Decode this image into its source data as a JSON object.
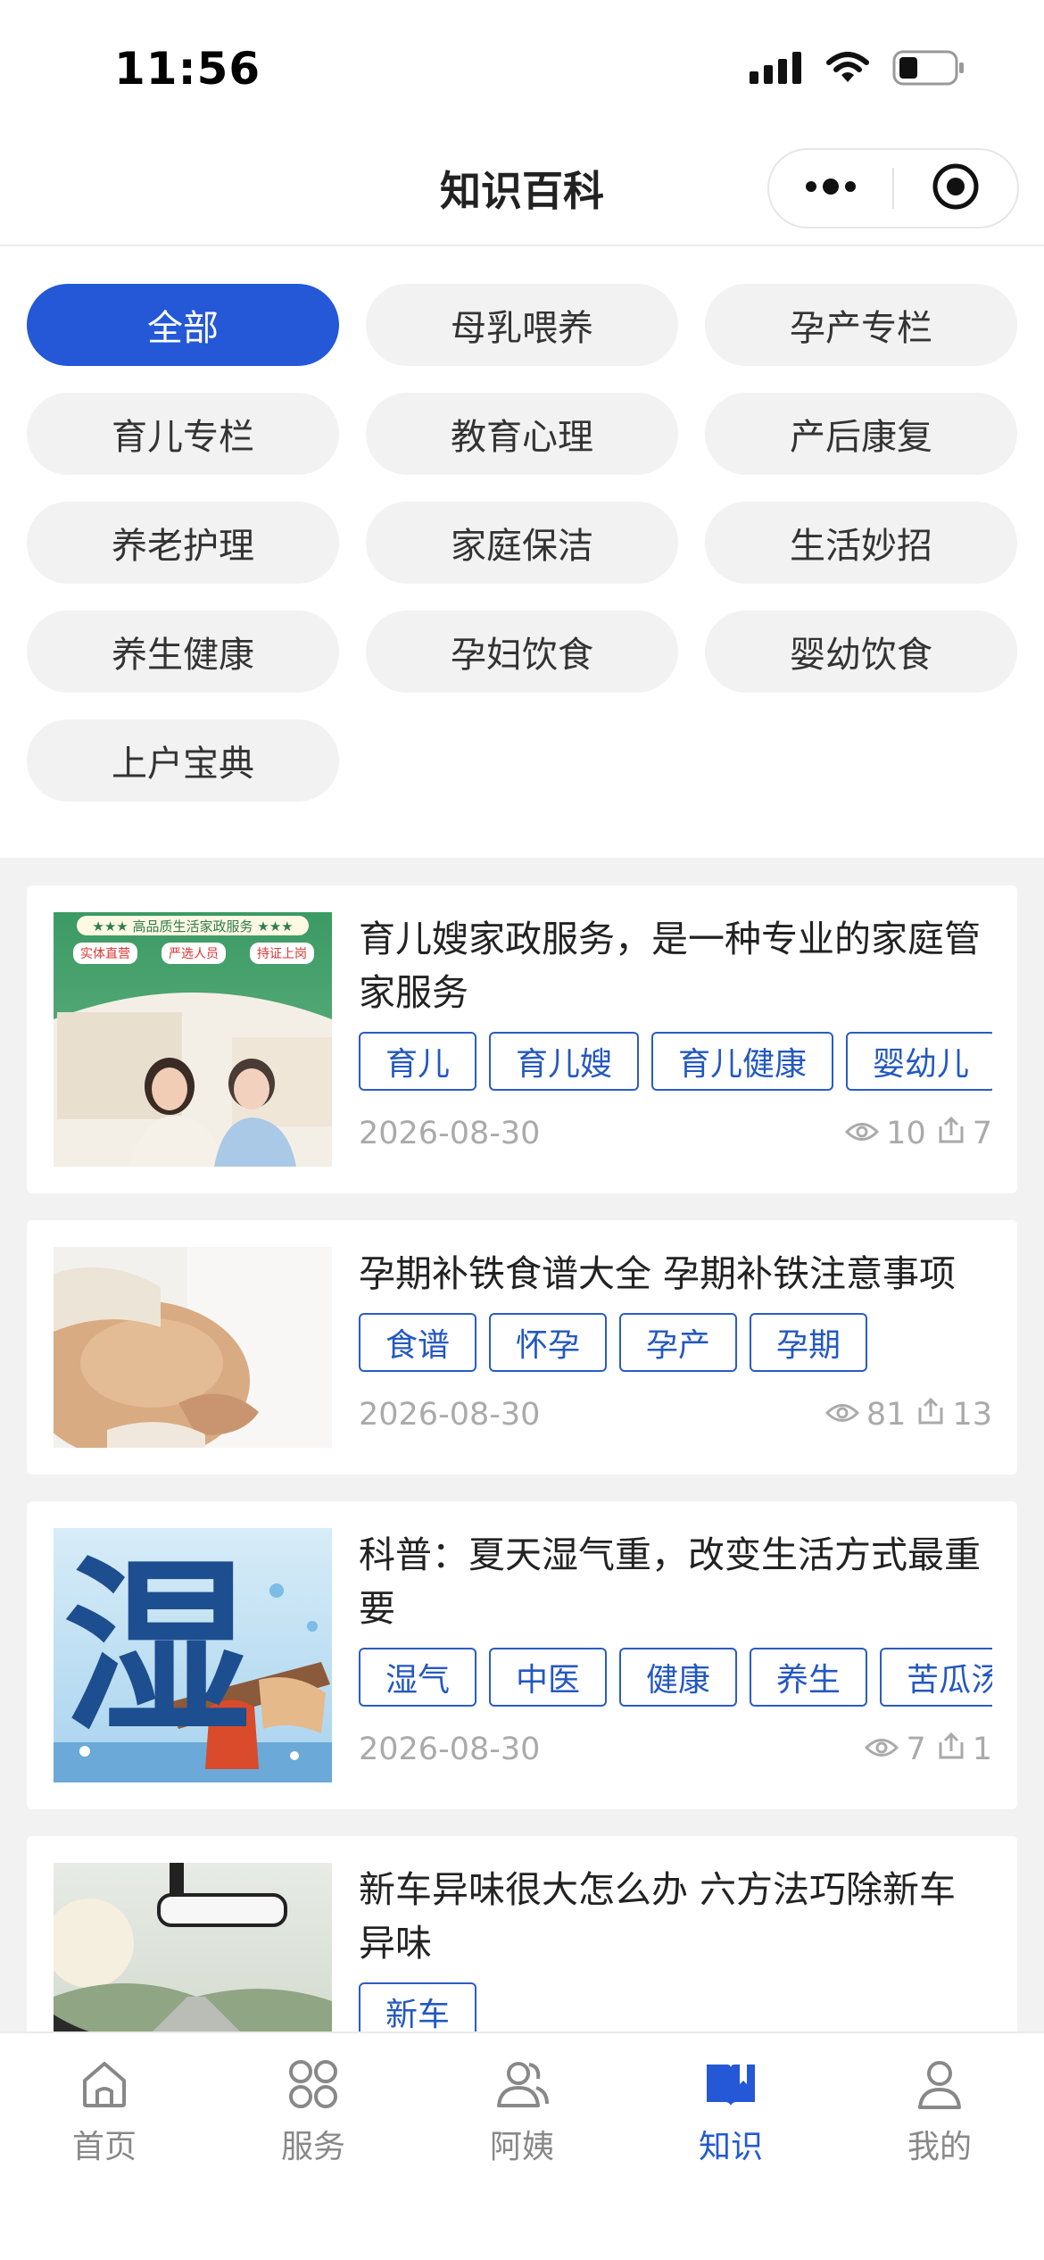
{
  "status_bar": {
    "time": "11:56"
  },
  "nav": {
    "title": "知识百科"
  },
  "categories": [
    {
      "label": "全部",
      "active": true
    },
    {
      "label": "母乳喂养"
    },
    {
      "label": "孕产专栏"
    },
    {
      "label": "育儿专栏"
    },
    {
      "label": "教育心理"
    },
    {
      "label": "产后康复"
    },
    {
      "label": "养老护理"
    },
    {
      "label": "家庭保洁"
    },
    {
      "label": "生活妙招"
    },
    {
      "label": "养生健康"
    },
    {
      "label": "孕妇饮食"
    },
    {
      "label": "婴幼饮食"
    },
    {
      "label": "上户宝典"
    }
  ],
  "articles": [
    {
      "title": "育儿嫂家政服务，是一种专业的家庭管家服务",
      "tags": [
        "育儿",
        "育儿嫂",
        "育儿健康",
        "婴幼儿"
      ],
      "date": "2026-08-30",
      "views": "10",
      "shares": "7",
      "thumb_text": {
        "banner": "★★★ 高品质生活家政服务 ★★★",
        "badges": [
          "实体直营",
          "严选人员",
          "持证上岗"
        ]
      }
    },
    {
      "title": "孕期补铁食谱大全 孕期补铁注意事项",
      "tags": [
        "食谱",
        "怀孕",
        "孕产",
        "孕期"
      ],
      "date": "2026-08-30",
      "views": "81",
      "shares": "13"
    },
    {
      "title": "科普：夏天湿气重，改变生活方式最重要",
      "tags": [
        "湿气",
        "中医",
        "健康",
        "养生",
        "苦瓜汤"
      ],
      "date": "2026-08-30",
      "views": "7",
      "shares": "1",
      "thumb_text": {
        "big_char": "湿"
      }
    },
    {
      "title": "新车异味很大怎么办 六方法巧除新车异味",
      "tags": [
        "新车"
      ]
    }
  ],
  "tabbar": [
    {
      "label": "首页",
      "icon": "home-icon"
    },
    {
      "label": "服务",
      "icon": "grid-icon"
    },
    {
      "label": "阿姨",
      "icon": "people-icon"
    },
    {
      "label": "知识",
      "icon": "book-icon",
      "active": true
    },
    {
      "label": "我的",
      "icon": "user-icon"
    }
  ],
  "colors": {
    "accent": "#2458d6",
    "tag_border": "#2a5cc4",
    "muted": "#aaaaaa"
  }
}
